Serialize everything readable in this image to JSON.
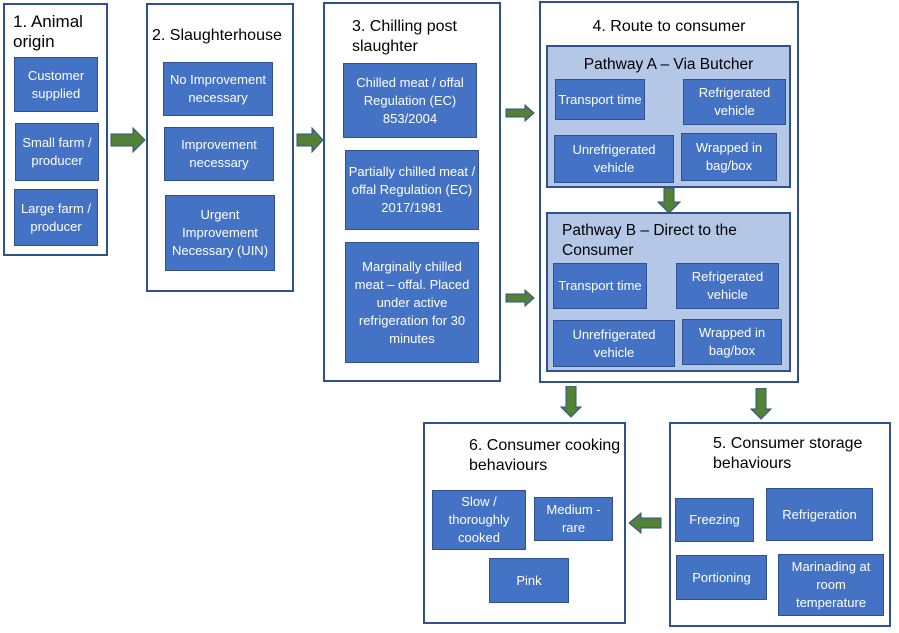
{
  "stages": {
    "animal_origin": {
      "title": "1. Animal origin",
      "items": [
        "Customer supplied",
        "Small farm / producer",
        "Large farm / producer"
      ]
    },
    "slaughterhouse": {
      "title": "2. Slaughterhouse",
      "items": [
        "No Improvement necessary",
        "Improvement necessary",
        "Urgent Improvement Necessary (UIN)"
      ]
    },
    "chilling": {
      "title": "3. Chilling post slaughter",
      "items": [
        "Chilled meat / offal Regulation (EC) 853/2004",
        "Partially chilled meat / offal Regulation (EC) 2017/1981",
        "Marginally chilled meat – offal. Placed under active refrigeration for 30 minutes"
      ]
    },
    "route": {
      "title": "4. Route to consumer",
      "pathway_a": {
        "title": "Pathway A – Via Butcher",
        "items": [
          "Transport time",
          "Refrigerated vehicle",
          "Unrefrigerated vehicle",
          "Wrapped in bag/box"
        ]
      },
      "pathway_b": {
        "title": "Pathway B – Direct to the Consumer",
        "items": [
          "Transport time",
          "Refrigerated vehicle",
          "Unrefrigerated vehicle",
          "Wrapped in bag/box"
        ]
      }
    },
    "storage": {
      "title": "5. Consumer storage behaviours",
      "items": [
        "Freezing",
        "Refrigeration",
        "Portioning",
        "Marinading at room temperature"
      ]
    },
    "cooking": {
      "title": "6. Consumer cooking behaviours",
      "items": [
        "Slow / thoroughly cooked",
        "Medium - rare",
        "Pink"
      ]
    }
  },
  "colors": {
    "item_fill": "#4472c4",
    "border": "#2f528f",
    "pathway_fill": "#b4c7e7",
    "arrow_fill": "#548235",
    "arrow_stroke": "#2f528f"
  }
}
